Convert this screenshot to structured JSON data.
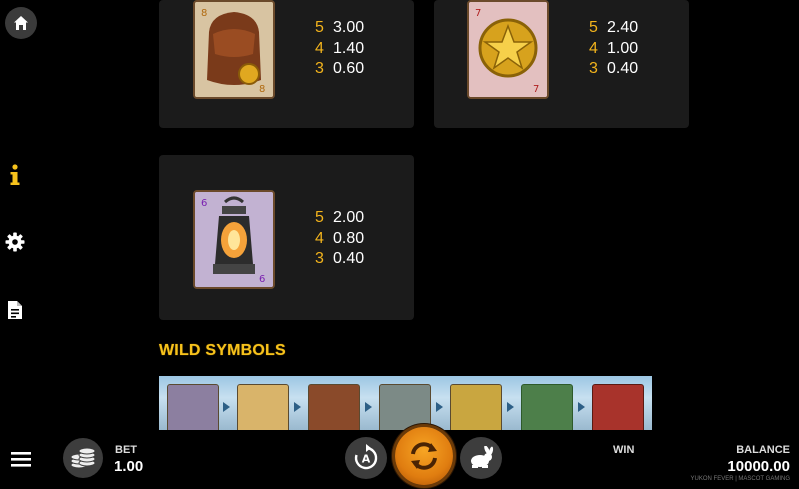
{
  "colors": {
    "accent": "#f2b31c",
    "panel": "#1b1b1b",
    "spin": "#e07d10"
  },
  "sidebar": {
    "home_icon": "home-icon",
    "info_icon": "info-icon",
    "settings_icon": "gear-icon",
    "rules_icon": "document-icon"
  },
  "paytable": {
    "symbols": [
      {
        "name": "satchel",
        "pays": [
          {
            "count": "5",
            "value": "3.00"
          },
          {
            "count": "4",
            "value": "1.40"
          },
          {
            "count": "3",
            "value": "0.60"
          }
        ]
      },
      {
        "name": "star-badge",
        "pays": [
          {
            "count": "5",
            "value": "2.40"
          },
          {
            "count": "4",
            "value": "1.00"
          },
          {
            "count": "3",
            "value": "0.40"
          }
        ]
      },
      {
        "name": "lantern",
        "pays": [
          {
            "count": "5",
            "value": "2.00"
          },
          {
            "count": "4",
            "value": "0.80"
          },
          {
            "count": "3",
            "value": "0.40"
          }
        ]
      }
    ],
    "wild_title": "WILD SYMBOLS"
  },
  "bottom": {
    "bet_label": "BET",
    "bet_value": "1.00",
    "win_label": "WIN",
    "balance_label": "BALANCE",
    "balance_value": "10000.00",
    "footer": "YUKON FEVER | MASCOT GAMING"
  }
}
